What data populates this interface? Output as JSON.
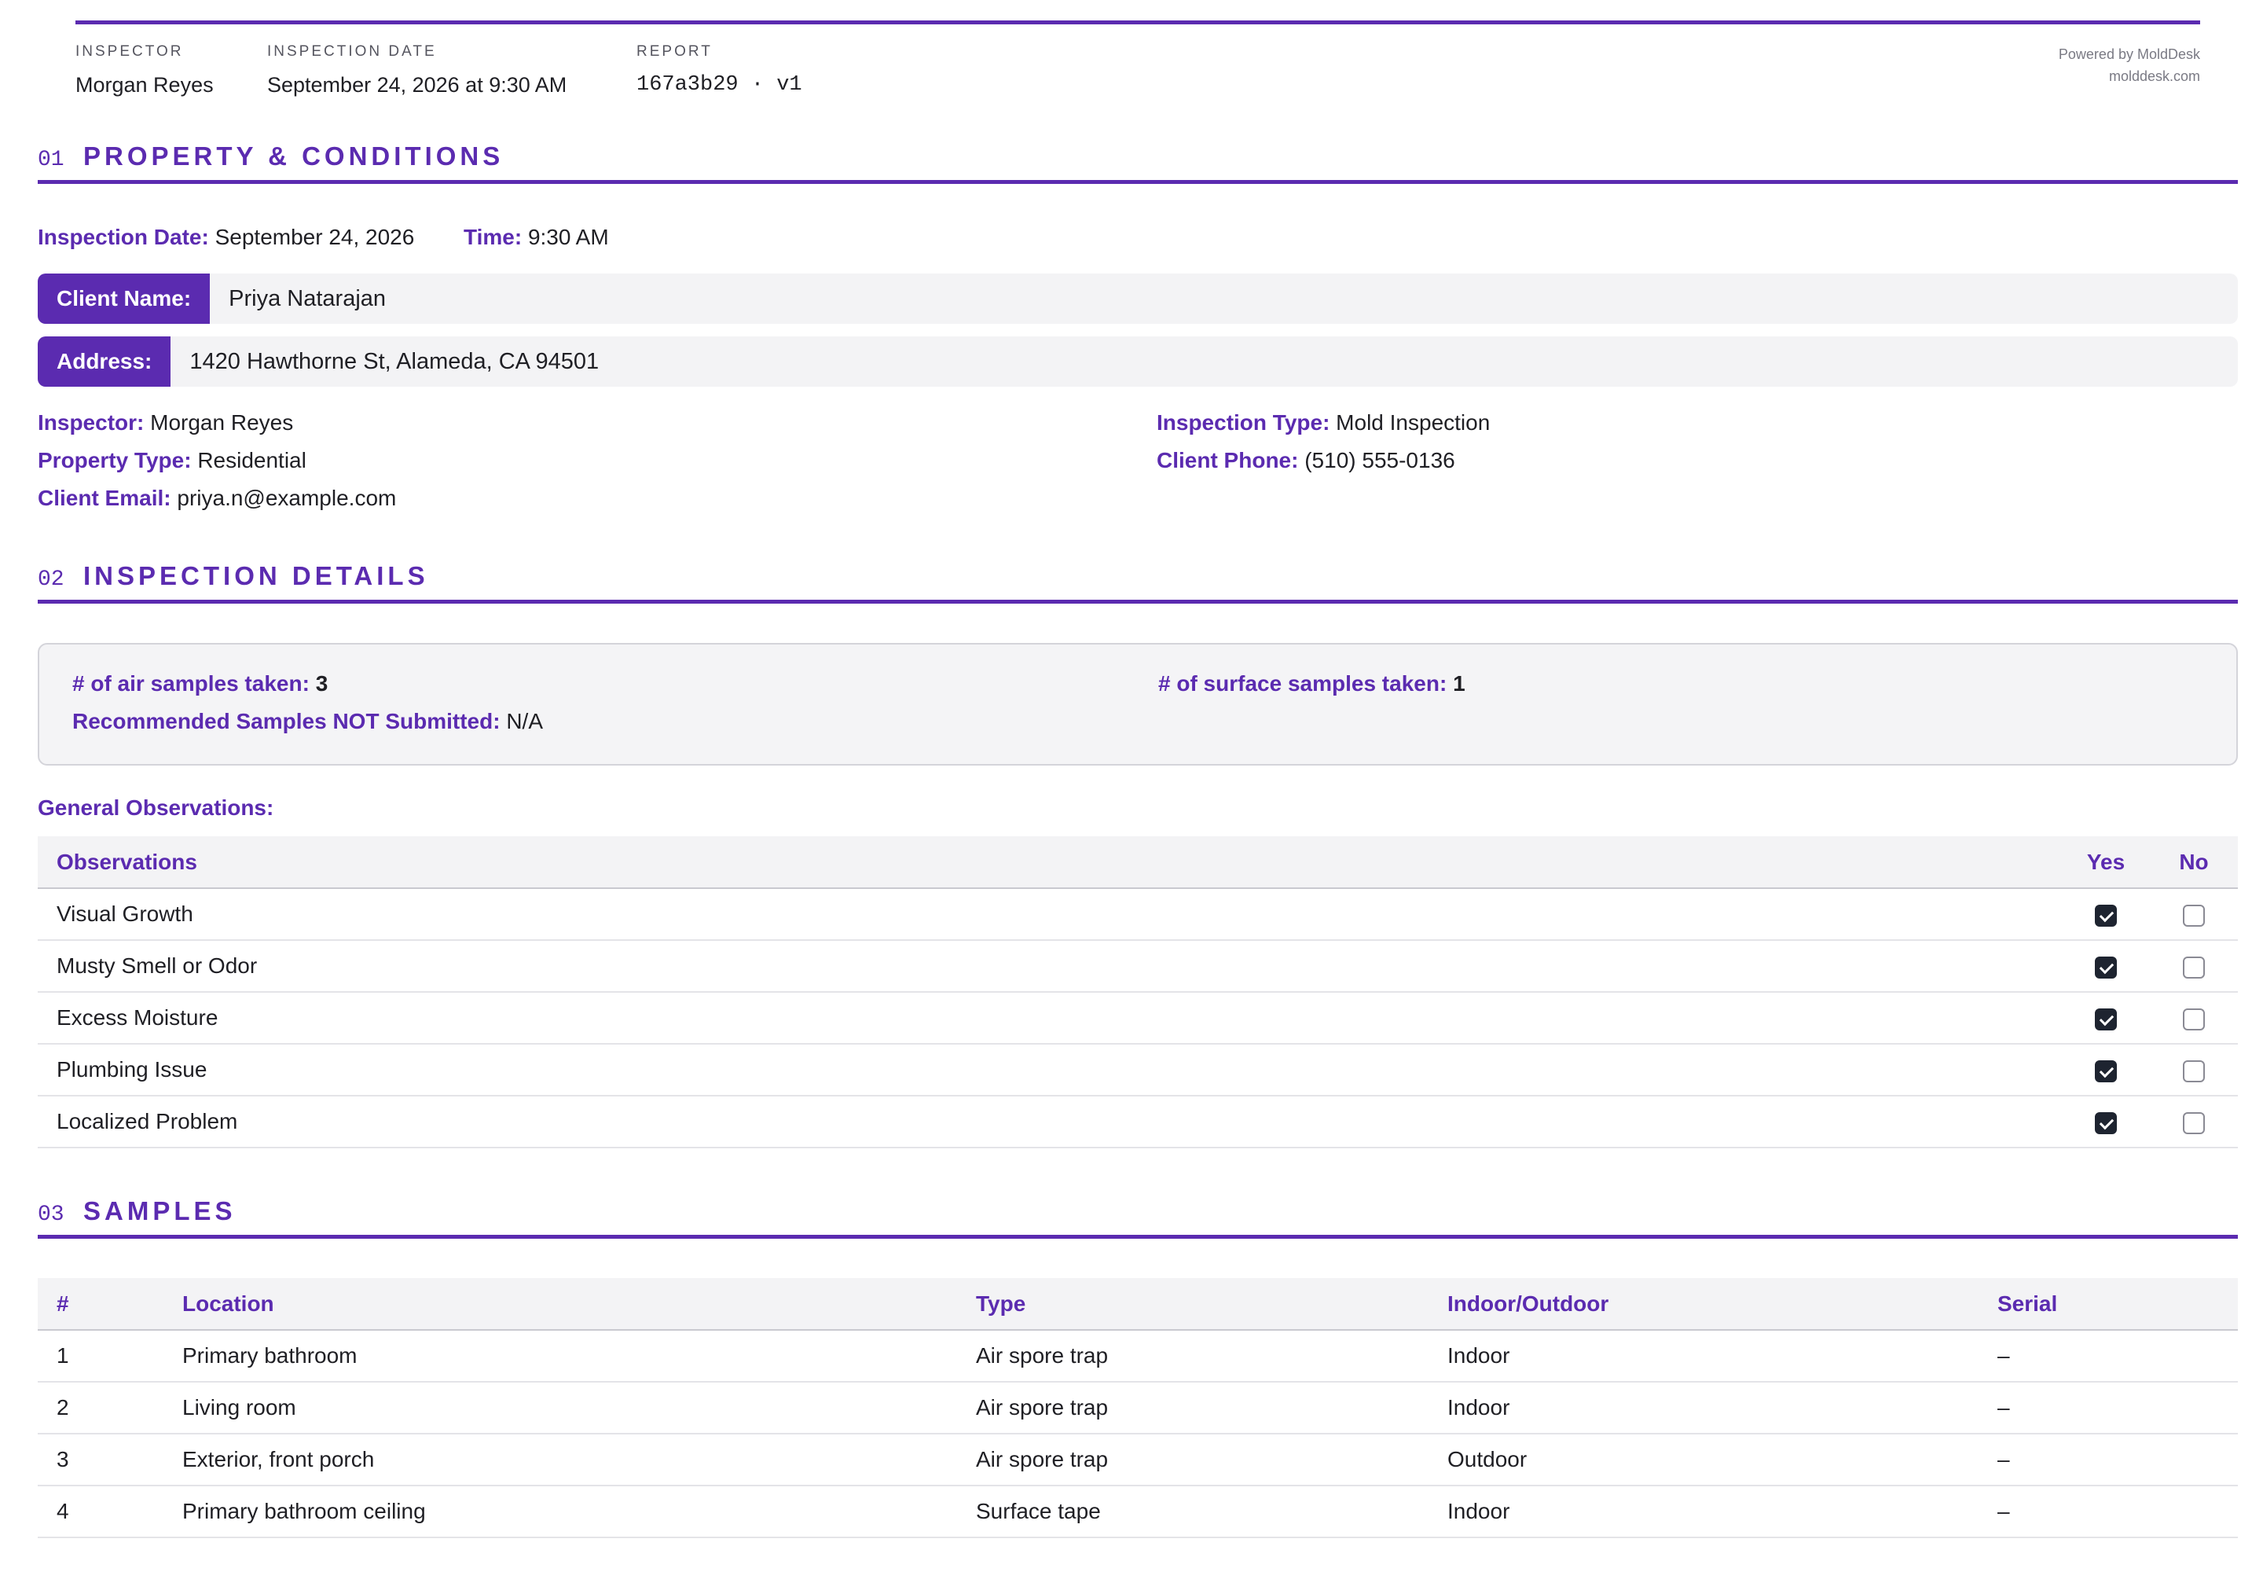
{
  "header": {
    "inspector_label": "INSPECTOR",
    "inspector": "Morgan Reyes",
    "date_label": "INSPECTION DATE",
    "date": "September 24, 2026 at 9:30 AM",
    "report_label": "REPORT",
    "report_id": "167a3b29 · v1",
    "powered_by": "Powered by MoldDesk",
    "site": "molddesk.com"
  },
  "section1": {
    "num": "01",
    "title": "PROPERTY & CONDITIONS",
    "inspection_date_label": "Inspection Date:",
    "inspection_date": "September 24, 2026",
    "time_label": "Time:",
    "time": "9:30 AM",
    "client_name_label": "Client Name:",
    "client_name": "Priya Natarajan",
    "address_label": "Address:",
    "address": "1420 Hawthorne St, Alameda, CA 94501",
    "inspector_label": "Inspector:",
    "inspector": "Morgan Reyes",
    "property_type_label": "Property Type:",
    "property_type": "Residential",
    "client_email_label": "Client Email:",
    "client_email": "priya.n@example.com",
    "inspection_type_label": "Inspection Type:",
    "inspection_type": "Mold Inspection",
    "client_phone_label": "Client Phone:",
    "client_phone": "(510) 555-0136"
  },
  "section2": {
    "num": "02",
    "title": "INSPECTION DETAILS",
    "air_label": "# of air samples taken:",
    "air": "3",
    "surface_label": "# of surface samples taken:",
    "surface": "1",
    "not_submitted_label": "Recommended Samples NOT Submitted:",
    "not_submitted": "N/A",
    "general_label": "General Observations:",
    "table": {
      "headers": [
        "Observations",
        "Yes",
        "No"
      ],
      "rows": [
        {
          "label": "Visual Growth",
          "yes": true
        },
        {
          "label": "Musty Smell or Odor",
          "yes": true
        },
        {
          "label": "Excess Moisture",
          "yes": true
        },
        {
          "label": "Plumbing Issue",
          "yes": true
        },
        {
          "label": "Localized Problem",
          "yes": true
        }
      ]
    }
  },
  "section3": {
    "num": "03",
    "title": "SAMPLES",
    "headers": [
      "#",
      "Location",
      "Type",
      "Indoor/Outdoor",
      "Serial"
    ],
    "rows": [
      [
        "1",
        "Primary bathroom",
        "Air spore trap",
        "Indoor",
        "–"
      ],
      [
        "2",
        "Living room",
        "Air spore trap",
        "Indoor",
        "–"
      ],
      [
        "3",
        "Exterior, front porch",
        "Air spore trap",
        "Outdoor",
        "–"
      ],
      [
        "4",
        "Primary bathroom ceiling",
        "Surface tape",
        "Indoor",
        "–"
      ]
    ]
  },
  "colors": {
    "accent": "#5b2bb0",
    "checkbox_on": "#1e2430"
  }
}
